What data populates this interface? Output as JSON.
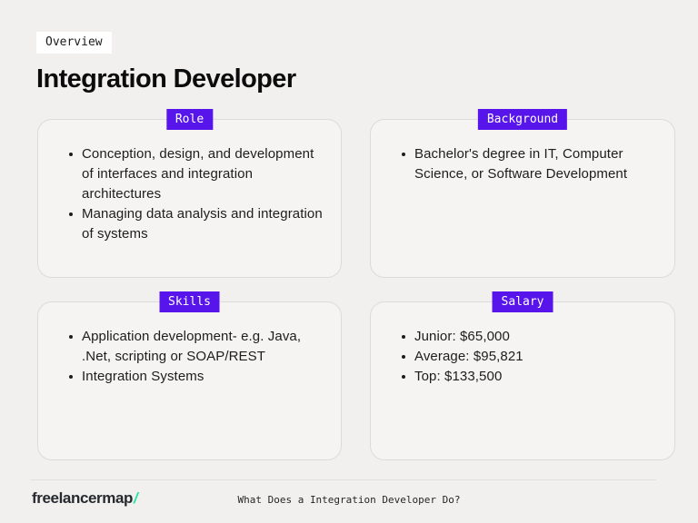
{
  "header": {
    "overview_label": "Overview",
    "title": "Integration Developer"
  },
  "cards": [
    {
      "label": "Role",
      "items": [
        "Conception, design, and development of interfaces and integration architectures",
        "Managing data analysis and integration of systems"
      ]
    },
    {
      "label": "Background",
      "items": [
        "Bachelor's degree in IT, Computer Science, or Software Development"
      ]
    },
    {
      "label": "Skills",
      "items": [
        "Application development- e.g. Java, .Net, scripting or SOAP/REST",
        "Integration Systems"
      ]
    },
    {
      "label": "Salary",
      "items": [
        "Junior: $65,000",
        "Average: $95,821",
        "Top: $133,500"
      ]
    }
  ],
  "footer": {
    "logo_text": "freelancermap",
    "logo_slash": "/",
    "caption": "What Does a Integration Developer Do?"
  },
  "colors": {
    "accent_purple": "#5714eb",
    "logo_mint": "#2de3a7",
    "page_background": "#f1f0ef",
    "card_background": "#f5f4f3",
    "card_border": "#dcdbda",
    "badge_background": "#ffffff"
  }
}
